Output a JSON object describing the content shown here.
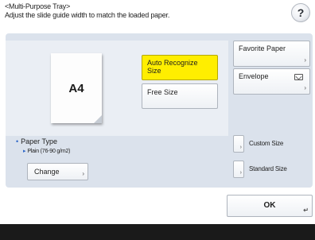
{
  "header": {
    "title": "<Multi-Purpose Tray>",
    "instruction": "Adjust the slide guide width to match the loaded paper."
  },
  "help": {
    "label": "?"
  },
  "paper": {
    "size_label": "A4"
  },
  "size_options": {
    "auto": "Auto Recognize Size",
    "free": "Free Size"
  },
  "paper_menu": {
    "favorite": "Favorite Paper",
    "envelope": "Envelope"
  },
  "size_buttons": {
    "custom": "Custom Size",
    "standard": "Standard Size"
  },
  "paper_type": {
    "label": "Paper Type",
    "value": "Plain (76-90 g/m2)",
    "change": "Change"
  },
  "actions": {
    "ok": "OK"
  },
  "colors": {
    "panel": "#dbe2ec",
    "selected": "#ffee00",
    "bullet": "#2e66c7",
    "bottom_bar": "#1a1a1a"
  }
}
